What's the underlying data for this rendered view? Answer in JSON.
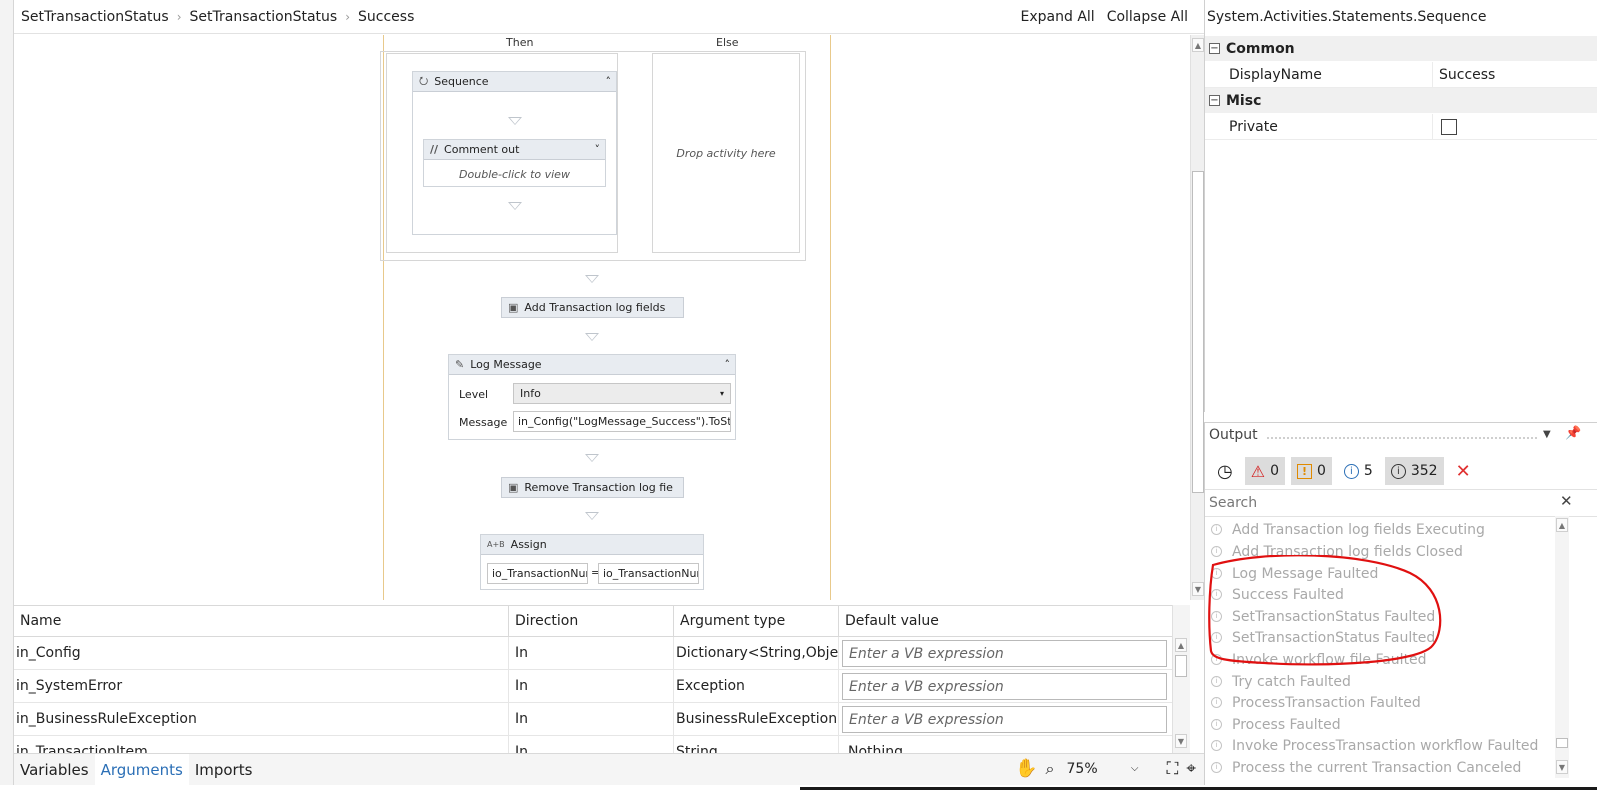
{
  "breadcrumb": {
    "items": [
      "SetTransactionStatus",
      "SetTransactionStatus",
      "Success"
    ],
    "expand_all": "Expand All",
    "collapse_all": "Collapse All"
  },
  "designer": {
    "then_label": "Then",
    "else_label": "Else",
    "sequence_title": "Sequence",
    "comment_title": "Comment out",
    "comment_hint": "Double-click to view",
    "drop_hint": "Drop activity here",
    "add_log_fields": "Add Transaction log fields",
    "log_message": {
      "title": "Log Message",
      "level_label": "Level",
      "level_value": "Info",
      "message_label": "Message",
      "message_value": "in_Config(\"LogMessage_Success\").ToString"
    },
    "remove_log_fields": "Remove Transaction log fie",
    "assign": {
      "title": "Assign",
      "icon_text": "A+B",
      "left": "io_TransactionNum",
      "eq": "=",
      "right": "io_TransactionNum"
    }
  },
  "arguments": {
    "headers": [
      "Name",
      "Direction",
      "Argument type",
      "Default value"
    ],
    "rows": [
      {
        "name": "in_Config",
        "direction": "In",
        "type": "Dictionary<String,Object",
        "default": "Enter a VB expression"
      },
      {
        "name": "in_SystemError",
        "direction": "In",
        "type": "Exception",
        "default": "Enter a VB expression"
      },
      {
        "name": "in_BusinessRuleException",
        "direction": "In",
        "type": "BusinessRuleException",
        "default": "Enter a VB expression"
      },
      {
        "name": "in_TransactionItem",
        "direction": "In",
        "type": "String",
        "default": "Nothing"
      }
    ]
  },
  "bottom_tabs": {
    "variables": "Variables",
    "arguments": "Arguments",
    "imports": "Imports",
    "zoom": "75%"
  },
  "properties": {
    "title": "System.Activities.Statements.Sequence",
    "cat_common": "Common",
    "display_name_label": "DisplayName",
    "display_name_value": "Success",
    "cat_misc": "Misc",
    "private_label": "Private"
  },
  "output": {
    "title": "Output",
    "errors": "0",
    "warnings": "0",
    "info": "5",
    "trace": "352",
    "search_placeholder": "Search",
    "items": [
      "Add Transaction log fields Executing",
      "Add Transaction log fields Closed",
      "Log Message Faulted",
      "Success Faulted",
      "SetTransactionStatus Faulted",
      "SetTransactionStatus Faulted",
      "Invoke workflow file Faulted",
      "Try catch Faulted",
      "ProcessTransaction Faulted",
      "Process Faulted",
      "Invoke ProcessTransaction workflow Faulted",
      "Process the current Transaction Canceled"
    ]
  },
  "colors": {
    "accent": "#2b6fb6",
    "annotation_red": "#e01010",
    "if_border": "#e8c98b"
  }
}
